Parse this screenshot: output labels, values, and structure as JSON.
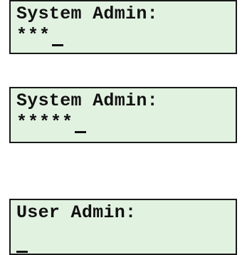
{
  "screens": [
    {
      "label": "System Admin:",
      "entry": "***"
    },
    {
      "label": "System Admin:",
      "entry": "*****"
    },
    {
      "label": "User Admin:",
      "entry": ""
    }
  ]
}
